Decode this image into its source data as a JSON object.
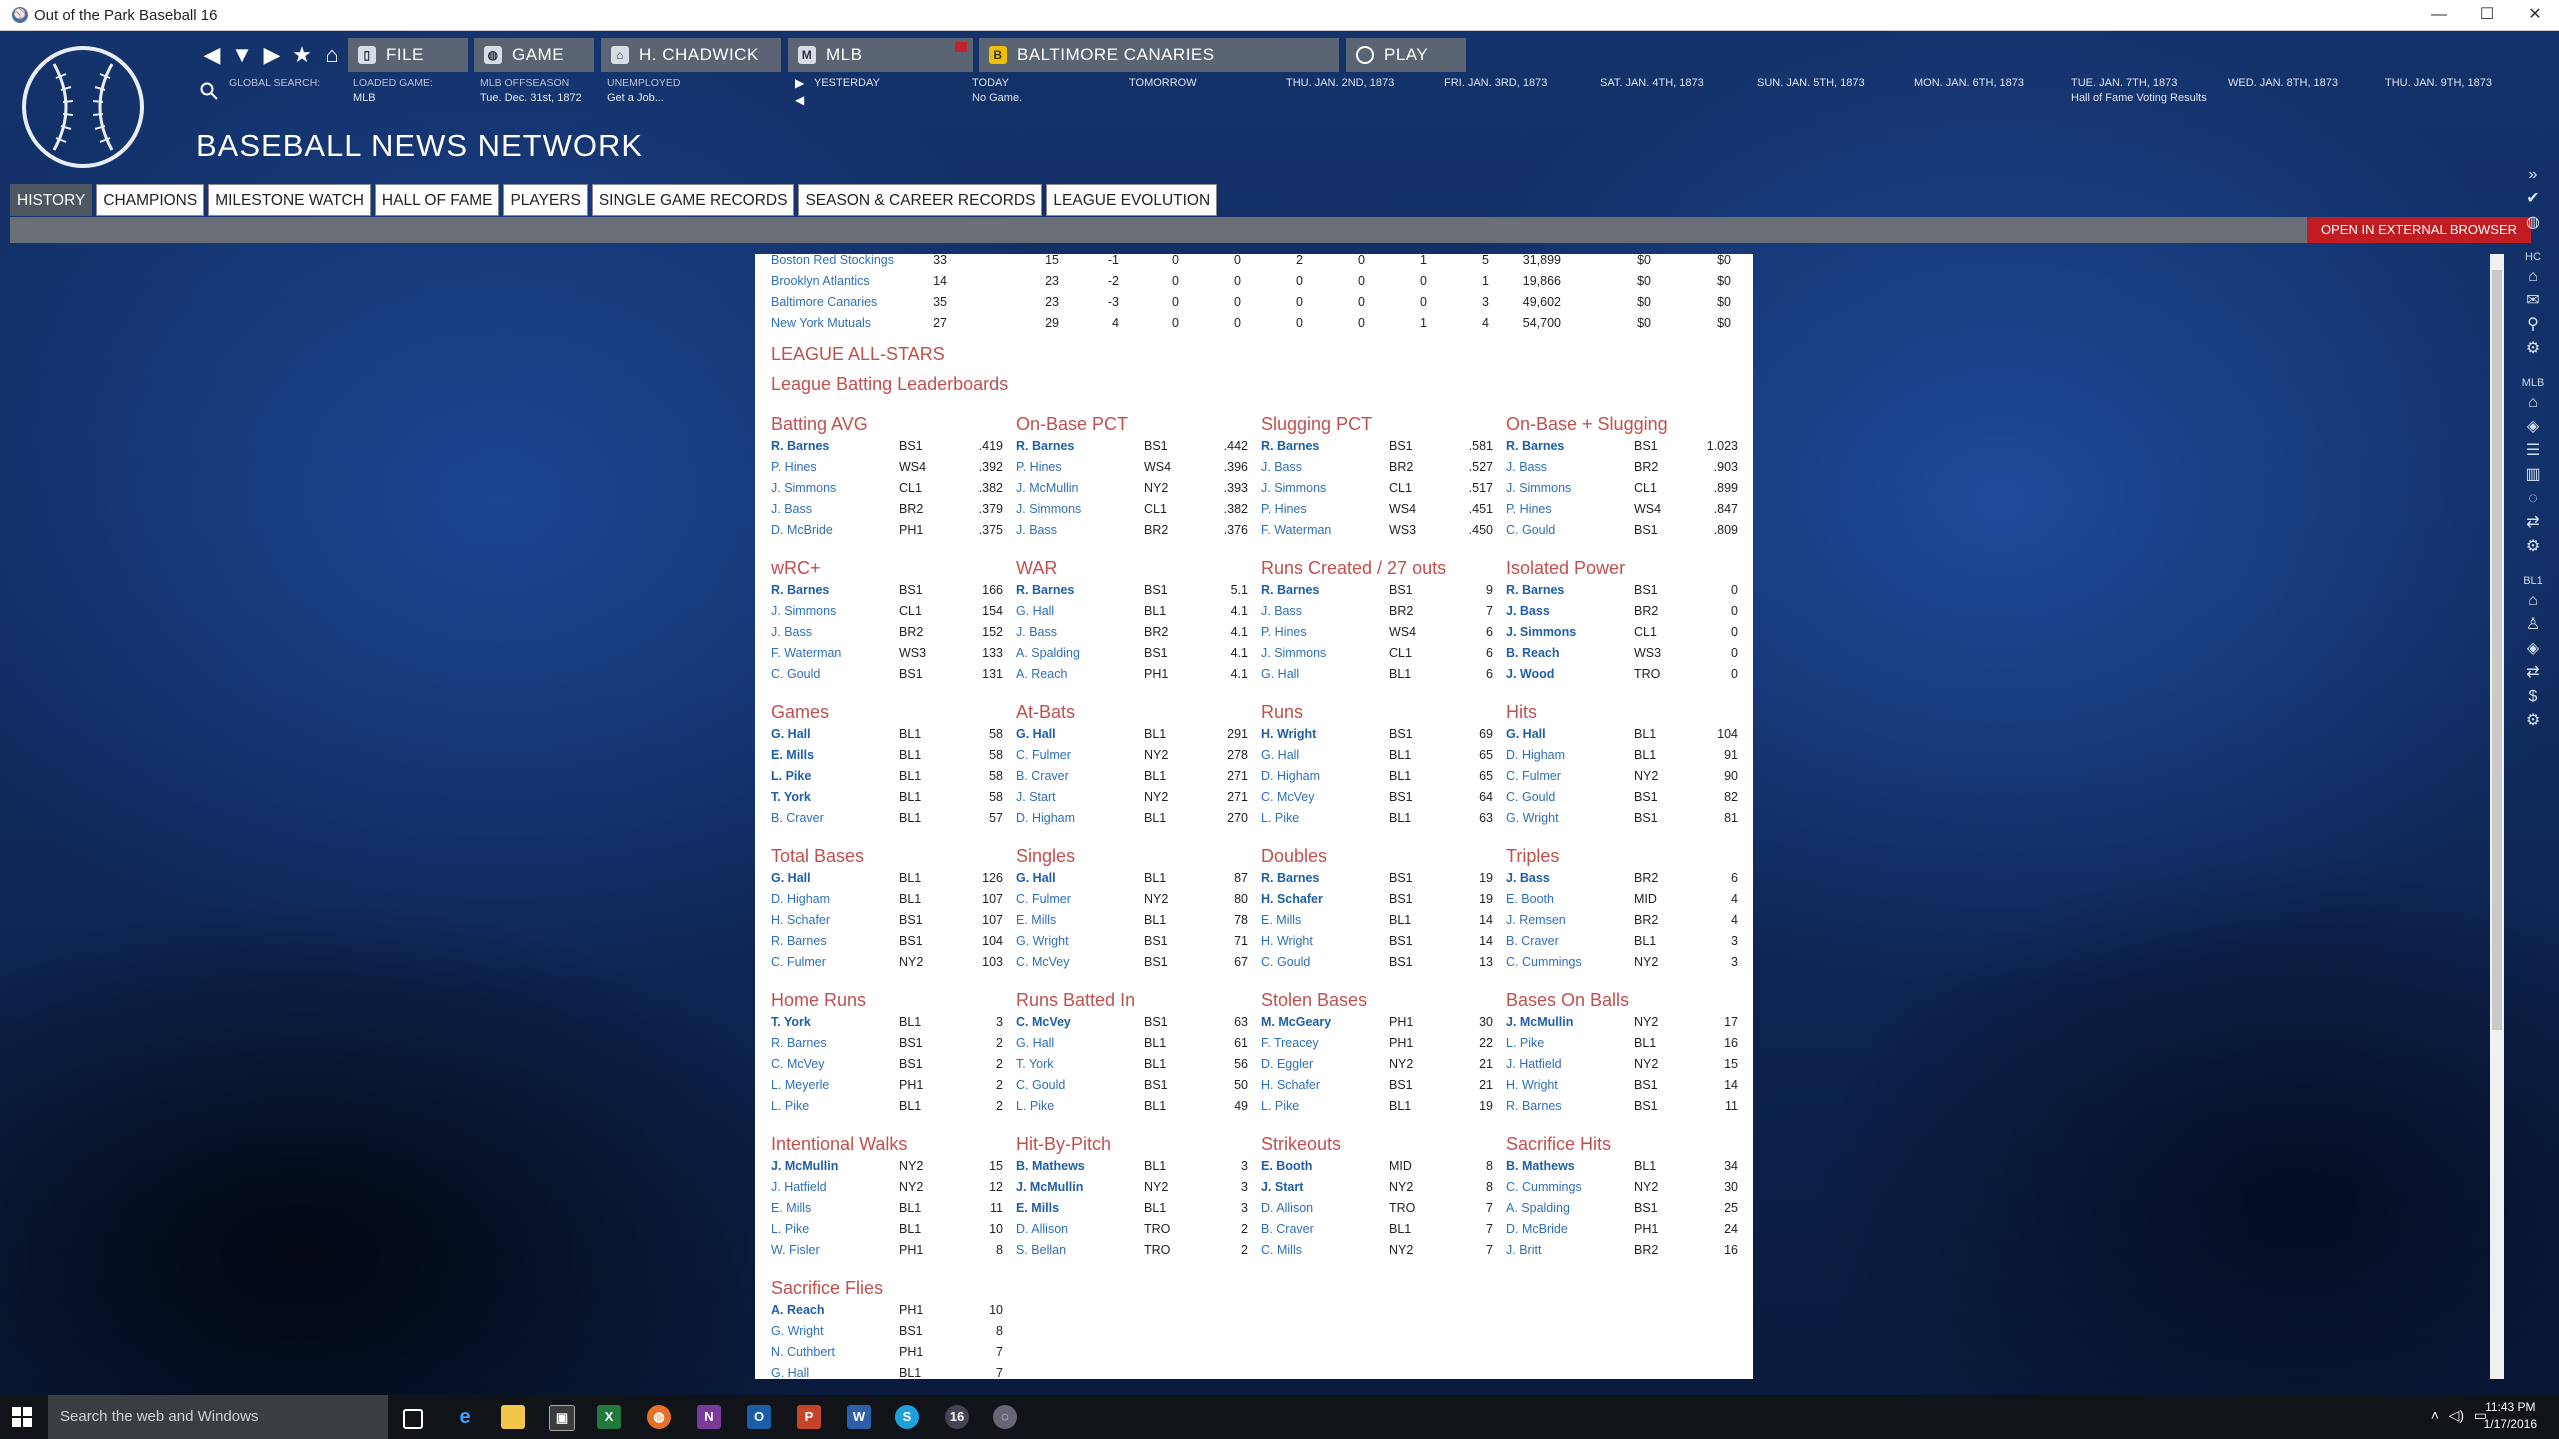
{
  "window": {
    "title": "Out of the Park Baseball 16"
  },
  "toolbar": {
    "file": "FILE",
    "game": "GAME",
    "manager": "H. CHADWICK",
    "league": "MLB",
    "team": "BALTIMORE CANARIES",
    "play": "PLAY"
  },
  "header": {
    "search_label": "GLOBAL SEARCH:",
    "loaded_label": "LOADED GAME:",
    "loaded_value": "MLB",
    "phase_label": "MLB OFFSEASON",
    "phase_value": "Tue. Dec. 31st, 1872",
    "status_label": "UNEMPLOYED",
    "status_value": "Get a Job...",
    "yesterday": "YESTERDAY",
    "today_label": "TODAY",
    "today_value": "No Game.",
    "tomorrow": "TOMORROW",
    "dates": [
      {
        "label": "THU. JAN. 2ND, 1873",
        "note": ""
      },
      {
        "label": "FRI. JAN. 3RD, 1873",
        "note": ""
      },
      {
        "label": "SAT. JAN. 4TH, 1873",
        "note": ""
      },
      {
        "label": "SUN. JAN. 5TH, 1873",
        "note": ""
      },
      {
        "label": "MON. JAN. 6TH, 1873",
        "note": ""
      },
      {
        "label": "TUE. JAN. 7TH, 1873",
        "note": "Hall of Fame Voting Results"
      },
      {
        "label": "WED. JAN. 8TH, 1873",
        "note": ""
      },
      {
        "label": "THU. JAN. 9TH, 1873",
        "note": ""
      }
    ]
  },
  "page": {
    "title": "BASEBALL NEWS NETWORK",
    "external_button": "OPEN IN EXTERNAL BROWSER"
  },
  "tabs": [
    "HISTORY",
    "CHAMPIONS",
    "MILESTONE WATCH",
    "HALL OF FAME",
    "PLAYERS",
    "SINGLE GAME RECORDS",
    "SEASON & CAREER RECORDS",
    "LEAGUE EVOLUTION"
  ],
  "sidebar_labels": [
    "HC",
    "MLB",
    "BL1"
  ],
  "team_rows": [
    [
      "Boston Red Stockings",
      "33",
      "15",
      "-1",
      "0",
      "0",
      "2",
      "0",
      "1",
      "5",
      "31,899",
      "$0",
      "$0"
    ],
    [
      "Brooklyn Atlantics",
      "14",
      "23",
      "-2",
      "0",
      "0",
      "0",
      "0",
      "0",
      "1",
      "19,866",
      "$0",
      "$0"
    ],
    [
      "Baltimore Canaries",
      "35",
      "23",
      "-3",
      "0",
      "0",
      "0",
      "0",
      "0",
      "3",
      "49,602",
      "$0",
      "$0"
    ],
    [
      "New York Mutuals",
      "27",
      "29",
      "4",
      "0",
      "0",
      "0",
      "0",
      "1",
      "4",
      "54,700",
      "$0",
      "$0"
    ]
  ],
  "section": {
    "allstars": "LEAGUE ALL-STARS",
    "batting": "League Batting Leaderboards"
  },
  "leaderboards": [
    {
      "title": "Batting AVG",
      "rows": [
        [
          "R. Barnes",
          "BS1",
          ".419",
          1
        ],
        [
          "P. Hines",
          "WS4",
          ".392",
          0
        ],
        [
          "J. Simmons",
          "CL1",
          ".382",
          0
        ],
        [
          "J. Bass",
          "BR2",
          ".379",
          0
        ],
        [
          "D. McBride",
          "PH1",
          ".375",
          0
        ]
      ]
    },
    {
      "title": "On-Base PCT",
      "rows": [
        [
          "R. Barnes",
          "BS1",
          ".442",
          1
        ],
        [
          "P. Hines",
          "WS4",
          ".396",
          0
        ],
        [
          "J. McMullin",
          "NY2",
          ".393",
          0
        ],
        [
          "J. Simmons",
          "CL1",
          ".382",
          0
        ],
        [
          "J. Bass",
          "BR2",
          ".376",
          0
        ]
      ]
    },
    {
      "title": "Slugging PCT",
      "rows": [
        [
          "R. Barnes",
          "BS1",
          ".581",
          1
        ],
        [
          "J. Bass",
          "BR2",
          ".527",
          0
        ],
        [
          "J. Simmons",
          "CL1",
          ".517",
          0
        ],
        [
          "P. Hines",
          "WS4",
          ".451",
          0
        ],
        [
          "F. Waterman",
          "WS3",
          ".450",
          0
        ]
      ]
    },
    {
      "title": "On-Base + Slugging",
      "rows": [
        [
          "R. Barnes",
          "BS1",
          "1.023",
          1
        ],
        [
          "J. Bass",
          "BR2",
          ".903",
          0
        ],
        [
          "J. Simmons",
          "CL1",
          ".899",
          0
        ],
        [
          "P. Hines",
          "WS4",
          ".847",
          0
        ],
        [
          "C. Gould",
          "BS1",
          ".809",
          0
        ]
      ]
    },
    {
      "title": "wRC+",
      "rows": [
        [
          "R. Barnes",
          "BS1",
          "166",
          1
        ],
        [
          "J. Simmons",
          "CL1",
          "154",
          0
        ],
        [
          "J. Bass",
          "BR2",
          "152",
          0
        ],
        [
          "F. Waterman",
          "WS3",
          "133",
          0
        ],
        [
          "C. Gould",
          "BS1",
          "131",
          0
        ]
      ]
    },
    {
      "title": "WAR",
      "rows": [
        [
          "R. Barnes",
          "BS1",
          "5.1",
          1
        ],
        [
          "G. Hall",
          "BL1",
          "4.1",
          0
        ],
        [
          "J. Bass",
          "BR2",
          "4.1",
          0
        ],
        [
          "A. Spalding",
          "BS1",
          "4.1",
          0
        ],
        [
          "A. Reach",
          "PH1",
          "4.1",
          0
        ]
      ]
    },
    {
      "title": "Runs Created / 27 outs",
      "rows": [
        [
          "R. Barnes",
          "BS1",
          "9",
          1
        ],
        [
          "J. Bass",
          "BR2",
          "7",
          0
        ],
        [
          "P. Hines",
          "WS4",
          "6",
          0
        ],
        [
          "J. Simmons",
          "CL1",
          "6",
          0
        ],
        [
          "G. Hall",
          "BL1",
          "6",
          0
        ]
      ]
    },
    {
      "title": "Isolated Power",
      "rows": [
        [
          "R. Barnes",
          "BS1",
          "0",
          1
        ],
        [
          "J. Bass",
          "BR2",
          "0",
          1
        ],
        [
          "J. Simmons",
          "CL1",
          "0",
          1
        ],
        [
          "B. Reach",
          "WS3",
          "0",
          1
        ],
        [
          "J. Wood",
          "TRO",
          "0",
          1
        ]
      ]
    },
    {
      "title": "Games",
      "rows": [
        [
          "G. Hall",
          "BL1",
          "58",
          1
        ],
        [
          "E. Mills",
          "BL1",
          "58",
          1
        ],
        [
          "L. Pike",
          "BL1",
          "58",
          1
        ],
        [
          "T. York",
          "BL1",
          "58",
          1
        ],
        [
          "B. Craver",
          "BL1",
          "57",
          0
        ]
      ]
    },
    {
      "title": "At-Bats",
      "rows": [
        [
          "G. Hall",
          "BL1",
          "291",
          1
        ],
        [
          "C. Fulmer",
          "NY2",
          "278",
          0
        ],
        [
          "B. Craver",
          "BL1",
          "271",
          0
        ],
        [
          "J. Start",
          "NY2",
          "271",
          0
        ],
        [
          "D. Higham",
          "BL1",
          "270",
          0
        ]
      ]
    },
    {
      "title": "Runs",
      "rows": [
        [
          "H. Wright",
          "BS1",
          "69",
          1
        ],
        [
          "G. Hall",
          "BL1",
          "65",
          0
        ],
        [
          "D. Higham",
          "BL1",
          "65",
          0
        ],
        [
          "C. McVey",
          "BS1",
          "64",
          0
        ],
        [
          "L. Pike",
          "BL1",
          "63",
          0
        ]
      ]
    },
    {
      "title": "Hits",
      "rows": [
        [
          "G. Hall",
          "BL1",
          "104",
          1
        ],
        [
          "D. Higham",
          "BL1",
          "91",
          0
        ],
        [
          "C. Fulmer",
          "NY2",
          "90",
          0
        ],
        [
          "C. Gould",
          "BS1",
          "82",
          0
        ],
        [
          "G. Wright",
          "BS1",
          "81",
          0
        ]
      ]
    },
    {
      "title": "Total Bases",
      "rows": [
        [
          "G. Hall",
          "BL1",
          "126",
          1
        ],
        [
          "D. Higham",
          "BL1",
          "107",
          0
        ],
        [
          "H. Schafer",
          "BS1",
          "107",
          0
        ],
        [
          "R. Barnes",
          "BS1",
          "104",
          0
        ],
        [
          "C. Fulmer",
          "NY2",
          "103",
          0
        ]
      ]
    },
    {
      "title": "Singles",
      "rows": [
        [
          "G. Hall",
          "BL1",
          "87",
          1
        ],
        [
          "C. Fulmer",
          "NY2",
          "80",
          0
        ],
        [
          "E. Mills",
          "BL1",
          "78",
          0
        ],
        [
          "G. Wright",
          "BS1",
          "71",
          0
        ],
        [
          "C. McVey",
          "BS1",
          "67",
          0
        ]
      ]
    },
    {
      "title": "Doubles",
      "rows": [
        [
          "R. Barnes",
          "BS1",
          "19",
          1
        ],
        [
          "H. Schafer",
          "BS1",
          "19",
          1
        ],
        [
          "E. Mills",
          "BL1",
          "14",
          0
        ],
        [
          "H. Wright",
          "BS1",
          "14",
          0
        ],
        [
          "C. Gould",
          "BS1",
          "13",
          0
        ]
      ]
    },
    {
      "title": "Triples",
      "rows": [
        [
          "J. Bass",
          "BR2",
          "6",
          1
        ],
        [
          "E. Booth",
          "MID",
          "4",
          0
        ],
        [
          "J. Remsen",
          "BR2",
          "4",
          0
        ],
        [
          "B. Craver",
          "BL1",
          "3",
          0
        ],
        [
          "C. Cummings",
          "NY2",
          "3",
          0
        ]
      ]
    },
    {
      "title": "Home Runs",
      "rows": [
        [
          "T. York",
          "BL1",
          "3",
          1
        ],
        [
          "R. Barnes",
          "BS1",
          "2",
          0
        ],
        [
          "C. McVey",
          "BS1",
          "2",
          0
        ],
        [
          "L. Meyerle",
          "PH1",
          "2",
          0
        ],
        [
          "L. Pike",
          "BL1",
          "2",
          0
        ]
      ]
    },
    {
      "title": "Runs Batted In",
      "rows": [
        [
          "C. McVey",
          "BS1",
          "63",
          1
        ],
        [
          "G. Hall",
          "BL1",
          "61",
          0
        ],
        [
          "T. York",
          "BL1",
          "56",
          0
        ],
        [
          "C. Gould",
          "BS1",
          "50",
          0
        ],
        [
          "L. Pike",
          "BL1",
          "49",
          0
        ]
      ]
    },
    {
      "title": "Stolen Bases",
      "rows": [
        [
          "M. McGeary",
          "PH1",
          "30",
          1
        ],
        [
          "F. Treacey",
          "PH1",
          "22",
          0
        ],
        [
          "D. Eggler",
          "NY2",
          "21",
          0
        ],
        [
          "H. Schafer",
          "BS1",
          "21",
          0
        ],
        [
          "L. Pike",
          "BL1",
          "19",
          0
        ]
      ]
    },
    {
      "title": "Bases On Balls",
      "rows": [
        [
          "J. McMullin",
          "NY2",
          "17",
          1
        ],
        [
          "L. Pike",
          "BL1",
          "16",
          0
        ],
        [
          "J. Hatfield",
          "NY2",
          "15",
          0
        ],
        [
          "H. Wright",
          "BS1",
          "14",
          0
        ],
        [
          "R. Barnes",
          "BS1",
          "11",
          0
        ]
      ]
    },
    {
      "title": "Intentional Walks",
      "rows": [
        [
          "J. McMullin",
          "NY2",
          "15",
          1
        ],
        [
          "J. Hatfield",
          "NY2",
          "12",
          0
        ],
        [
          "E. Mills",
          "BL1",
          "11",
          0
        ],
        [
          "L. Pike",
          "BL1",
          "10",
          0
        ],
        [
          "W. Fisler",
          "PH1",
          "8",
          0
        ]
      ]
    },
    {
      "title": "Hit-By-Pitch",
      "rows": [
        [
          "B. Mathews",
          "BL1",
          "3",
          1
        ],
        [
          "J. McMullin",
          "NY2",
          "3",
          1
        ],
        [
          "E. Mills",
          "BL1",
          "3",
          1
        ],
        [
          "D. Allison",
          "TRO",
          "2",
          0
        ],
        [
          "S. Bellan",
          "TRO",
          "2",
          0
        ]
      ]
    },
    {
      "title": "Strikeouts",
      "rows": [
        [
          "E. Booth",
          "MID",
          "8",
          1
        ],
        [
          "J. Start",
          "NY2",
          "8",
          1
        ],
        [
          "D. Allison",
          "TRO",
          "7",
          0
        ],
        [
          "B. Craver",
          "BL1",
          "7",
          0
        ],
        [
          "C. Mills",
          "NY2",
          "7",
          0
        ]
      ]
    },
    {
      "title": "Sacrifice Hits",
      "rows": [
        [
          "B. Mathews",
          "BL1",
          "34",
          1
        ],
        [
          "C. Cummings",
          "NY2",
          "30",
          0
        ],
        [
          "A. Spalding",
          "BS1",
          "25",
          0
        ],
        [
          "D. McBride",
          "PH1",
          "24",
          0
        ],
        [
          "J. Britt",
          "BR2",
          "16",
          0
        ]
      ]
    },
    {
      "title": "Sacrifice Flies",
      "rows": [
        [
          "A. Reach",
          "PH1",
          "10",
          1
        ],
        [
          "G. Wright",
          "BS1",
          "8",
          0
        ],
        [
          "N. Cuthbert",
          "PH1",
          "7",
          0
        ],
        [
          "G. Hall",
          "BL1",
          "7",
          0
        ]
      ]
    }
  ],
  "taskbar": {
    "search_placeholder": "Search the web and Windows",
    "time": "11:43 PM",
    "date": "1/17/2016"
  },
  "colors": {
    "accent": "#c0504d",
    "link": "#2f6fb5",
    "toolbar": "#5a6472",
    "external": "#c01c22"
  }
}
